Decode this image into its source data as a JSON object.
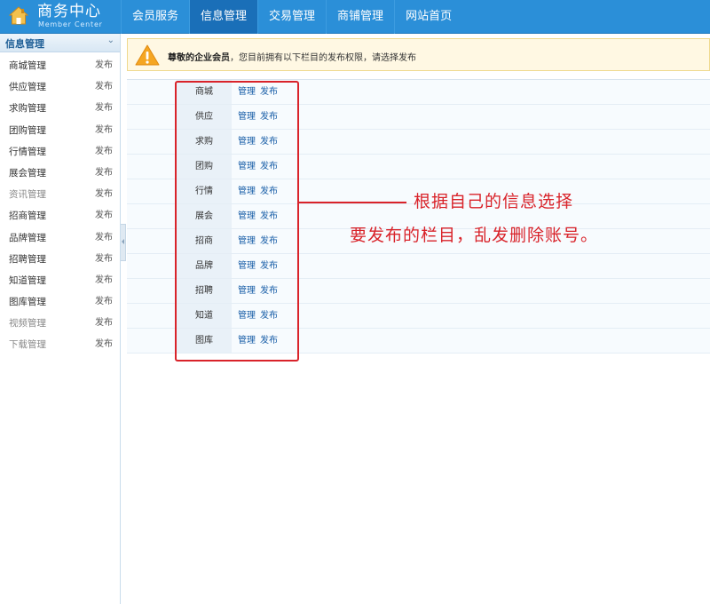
{
  "header": {
    "title": "商务中心",
    "subtitle": "Member Center",
    "nav": [
      {
        "label": "会员服务",
        "active": false
      },
      {
        "label": "信息管理",
        "active": true
      },
      {
        "label": "交易管理",
        "active": false
      },
      {
        "label": "商铺管理",
        "active": false
      },
      {
        "label": "网站首页",
        "active": false
      }
    ]
  },
  "sidebar": {
    "title": "信息管理",
    "items": [
      {
        "label": "商城管理",
        "action": "发布",
        "muted": false
      },
      {
        "label": "供应管理",
        "action": "发布",
        "muted": false
      },
      {
        "label": "求购管理",
        "action": "发布",
        "muted": false
      },
      {
        "label": "团购管理",
        "action": "发布",
        "muted": false
      },
      {
        "label": "行情管理",
        "action": "发布",
        "muted": false
      },
      {
        "label": "展会管理",
        "action": "发布",
        "muted": false
      },
      {
        "label": "资讯管理",
        "action": "发布",
        "muted": true
      },
      {
        "label": "招商管理",
        "action": "发布",
        "muted": false
      },
      {
        "label": "品牌管理",
        "action": "发布",
        "muted": false
      },
      {
        "label": "招聘管理",
        "action": "发布",
        "muted": false
      },
      {
        "label": "知道管理",
        "action": "发布",
        "muted": false
      },
      {
        "label": "图库管理",
        "action": "发布",
        "muted": false
      },
      {
        "label": "视频管理",
        "action": "发布",
        "muted": true
      },
      {
        "label": "下载管理",
        "action": "发布",
        "muted": true
      }
    ]
  },
  "notice": {
    "prefix": "尊敬的",
    "role": "企业会员",
    "rest": "，您目前拥有以下栏目的发布权限，请选择发布"
  },
  "modules": [
    {
      "name": "商城",
      "manage": "管理",
      "publish": "发布"
    },
    {
      "name": "供应",
      "manage": "管理",
      "publish": "发布"
    },
    {
      "name": "求购",
      "manage": "管理",
      "publish": "发布"
    },
    {
      "name": "团购",
      "manage": "管理",
      "publish": "发布"
    },
    {
      "name": "行情",
      "manage": "管理",
      "publish": "发布"
    },
    {
      "name": "展会",
      "manage": "管理",
      "publish": "发布"
    },
    {
      "name": "招商",
      "manage": "管理",
      "publish": "发布"
    },
    {
      "name": "品牌",
      "manage": "管理",
      "publish": "发布"
    },
    {
      "name": "招聘",
      "manage": "管理",
      "publish": "发布"
    },
    {
      "name": "知道",
      "manage": "管理",
      "publish": "发布"
    },
    {
      "name": "图库",
      "manage": "管理",
      "publish": "发布"
    }
  ],
  "annotation": {
    "line1": "根据自己的信息选择",
    "line2": "要发布的栏目，乱发删除账号。",
    "color": "#d9232a"
  },
  "icons": {
    "logo": "house-icon",
    "notice": "warning-icon",
    "sidebar_toggle": "chevron-down-icon",
    "collapse": "chevron-left-icon"
  },
  "colors": {
    "header_bg": "#2b8fd8",
    "header_active": "#1a6fb8",
    "link": "#1a5fa8",
    "notice_bg": "#fff8e3"
  }
}
